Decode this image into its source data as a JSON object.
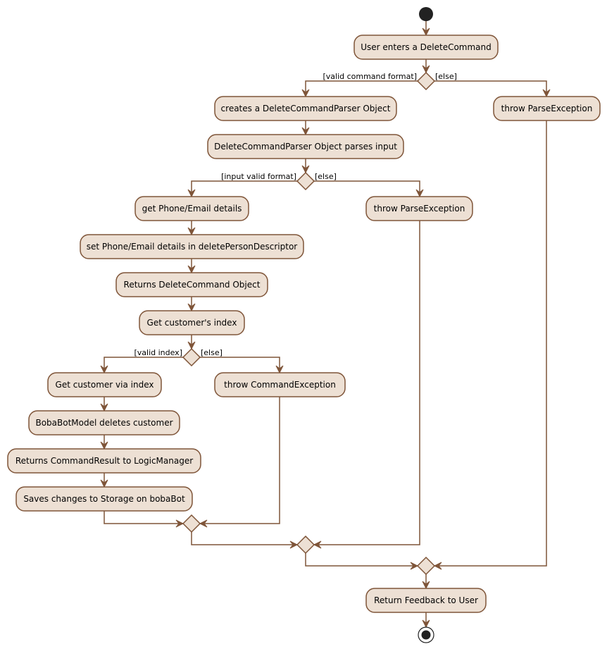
{
  "colors": {
    "fill": "#EDE0D4",
    "stroke": "#7F5539",
    "start_end": "#222222"
  },
  "activities": {
    "user_enters": "User enters a DeleteCommand",
    "creates_parser": "creates a DeleteCommandParser Object",
    "throw_parse_1": "throw ParseException",
    "parser_parses": "DeleteCommandParser Object parses input",
    "get_details": "get Phone/Email details",
    "throw_parse_2": "throw ParseException",
    "set_details": "set Phone/Email details in deletePersonDescriptor",
    "returns_delete": "Returns DeleteCommand Object",
    "get_index": "Get customer's index",
    "get_customer": "Get customer via index",
    "throw_command": "throw CommandException",
    "model_deletes": "BobaBotModel deletes customer",
    "returns_result": "Returns CommandResult to LogicManager",
    "saves_changes": "Saves changes to Storage on bobaBot",
    "return_feedback": "Return Feedback to User"
  },
  "guards": {
    "valid_command_format": "[valid command format]",
    "else_1": "[else]",
    "input_valid_format": "[input valid format]",
    "else_2": "[else]",
    "valid_index": "[valid index]",
    "else_3": "[else]"
  }
}
